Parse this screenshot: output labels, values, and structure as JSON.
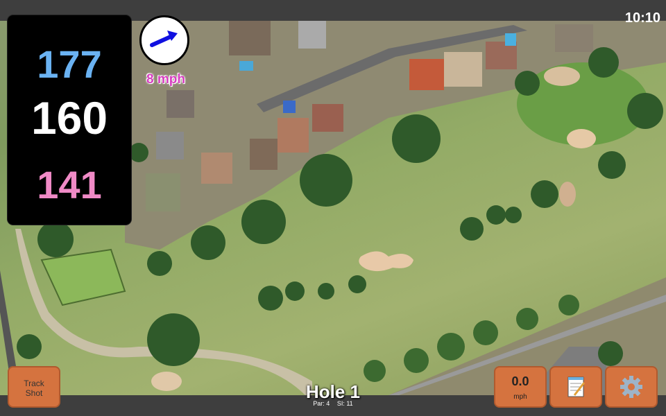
{
  "status": {
    "clock": "10:10"
  },
  "distances": {
    "back": "177",
    "middle": "160",
    "front": "141"
  },
  "wind": {
    "speed": "8 mph",
    "icon": "wind-arrow-icon",
    "arrow_color": "#1010e0"
  },
  "buttons": {
    "track_shot_line1": "Track",
    "track_shot_line2": "Shot",
    "speed_value": "0.0",
    "speed_unit": "mph",
    "notes_icon": "notepad-icon",
    "settings_icon": "gear-icon"
  },
  "hole": {
    "title": "Hole 1",
    "par": "Par: 4",
    "si": "SI: 11"
  },
  "colors": {
    "back_distance": "#6ab2f2",
    "middle_distance": "#ffffff",
    "front_distance": "#f08ac6",
    "button_bg": "#d5733f",
    "wind_text": "#d63fbf"
  }
}
